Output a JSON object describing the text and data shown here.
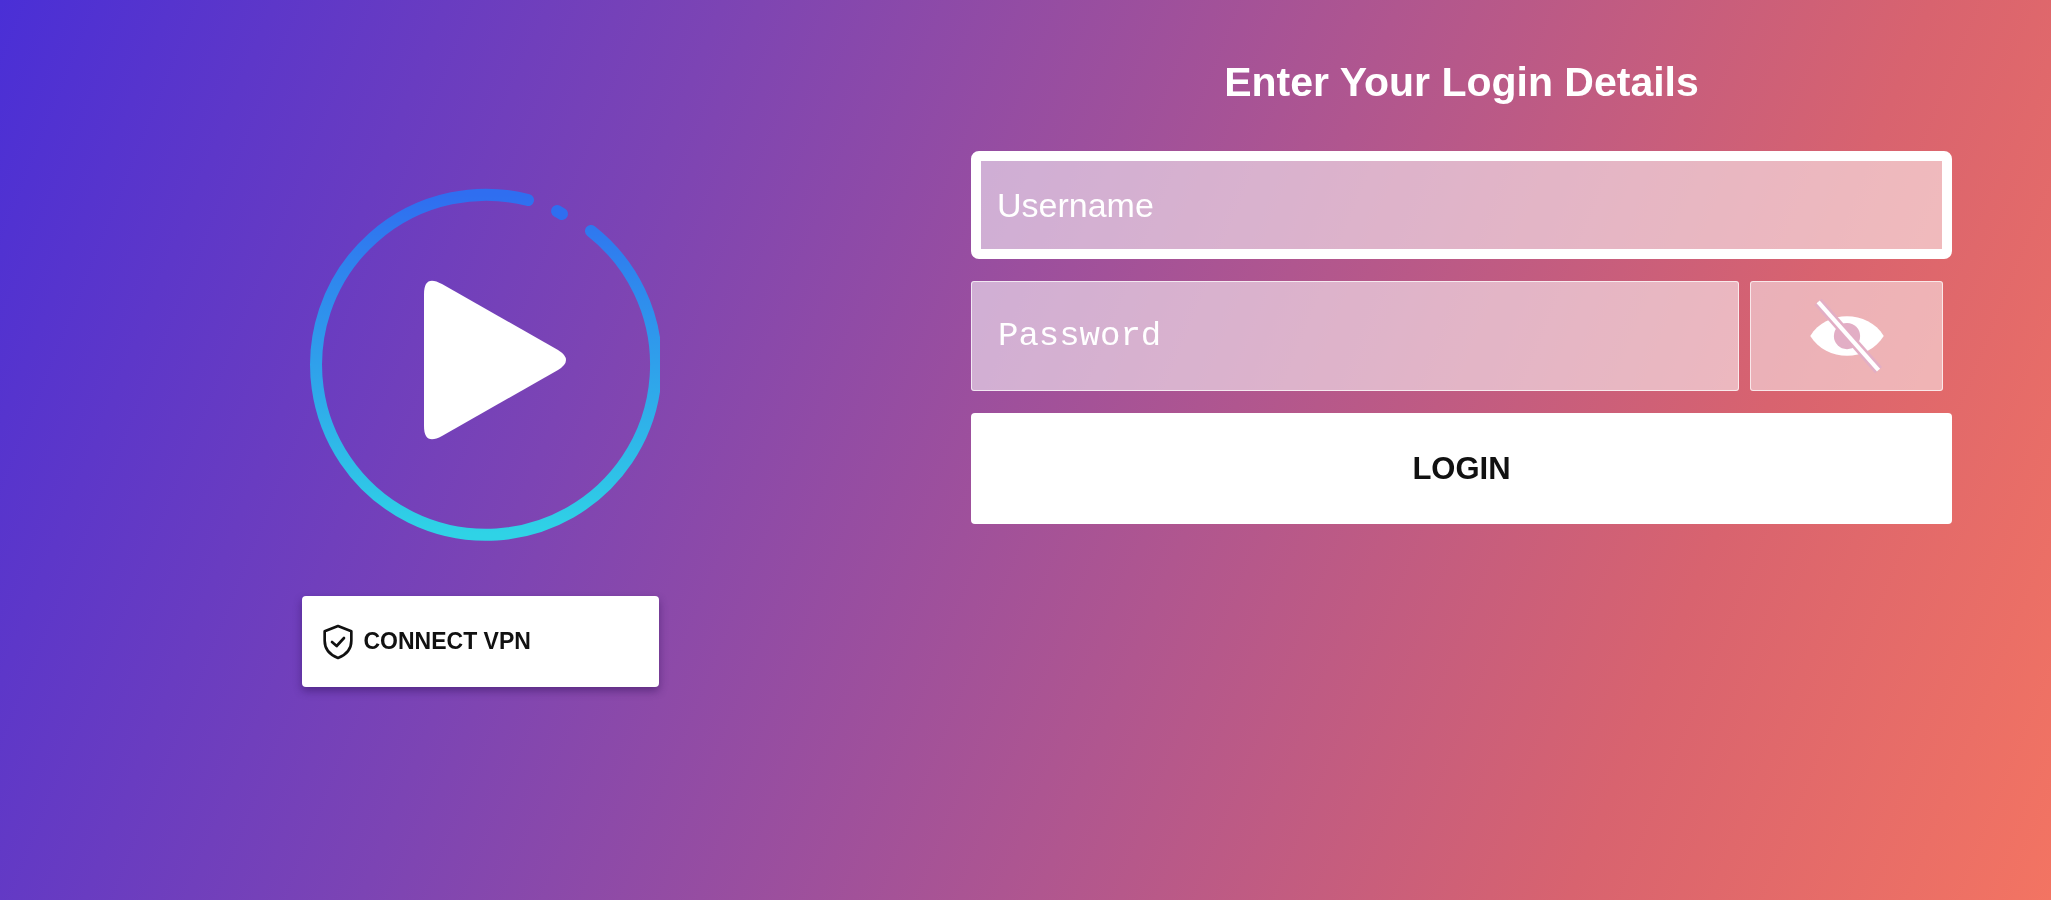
{
  "login_form": {
    "title": "Enter Your Login Details",
    "username": {
      "placeholder": "Username",
      "focused": true
    },
    "password": {
      "placeholder": "Password",
      "visible": false
    },
    "login_button": "LOGIN"
  },
  "vpn_button": {
    "label": "CONNECT VPN"
  }
}
